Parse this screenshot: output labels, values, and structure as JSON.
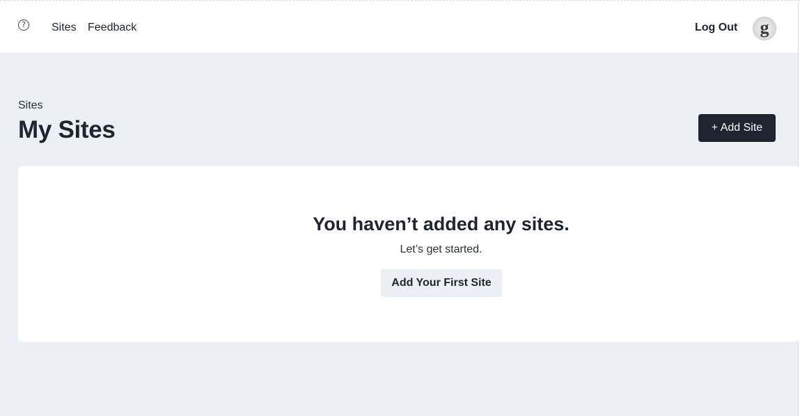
{
  "header": {
    "help_icon": "question-circle-icon",
    "help_glyph": "?",
    "nav": [
      {
        "label": "Sites"
      },
      {
        "label": "Feedback"
      }
    ],
    "logout_label": "Log Out",
    "avatar_letter": "g"
  },
  "page": {
    "breadcrumb": "Sites",
    "title": "My Sites",
    "add_site_label": "+ Add Site"
  },
  "empty_state": {
    "title": "You haven’t added any sites.",
    "subtitle": "Let’s get started.",
    "button_label": "Add Your First Site"
  },
  "colors": {
    "background": "#ecf0f4",
    "primary_button": "#1f2430",
    "text": "#1f2430"
  }
}
